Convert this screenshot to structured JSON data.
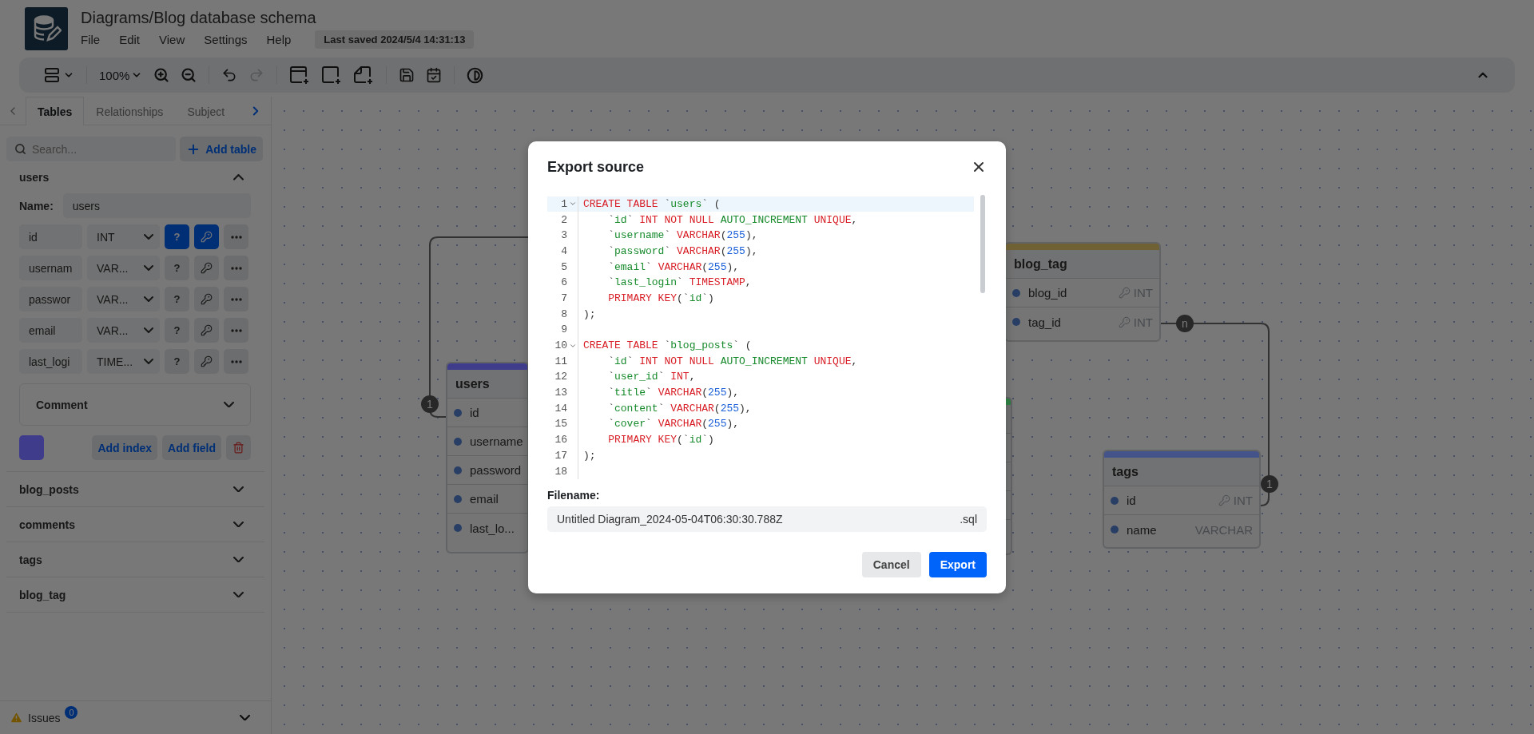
{
  "app": {
    "title": "Diagrams/Blog database schema",
    "menu": [
      "File",
      "Edit",
      "View",
      "Settings",
      "Help"
    ],
    "last_saved": "Last saved 2024/5/4 14:31:13"
  },
  "toolbar": {
    "zoom": "100%",
    "redo_disabled": true
  },
  "sidebar": {
    "tabs": [
      {
        "label": "Tables",
        "selected": true
      },
      {
        "label": "Relationships",
        "selected": false
      },
      {
        "label": "Subject",
        "selected": false
      }
    ],
    "search": {
      "placeholder": "Search..."
    },
    "add_table": "Add table",
    "tables": [
      {
        "name": "users",
        "expanded": true,
        "name_label": "Name:",
        "name_value": "users",
        "fields": [
          {
            "name": "id",
            "type": "INT",
            "not_null": true,
            "primary": true
          },
          {
            "name": "usernam",
            "type": "VAR...",
            "not_null": false,
            "primary": false
          },
          {
            "name": "passwor",
            "type": "VAR...",
            "not_null": false,
            "primary": false
          },
          {
            "name": "email",
            "type": "VAR...",
            "not_null": false,
            "primary": false
          },
          {
            "name": "last_logi",
            "type": "TIME...",
            "not_null": false,
            "primary": false
          }
        ],
        "null_symbol": "?",
        "comment": "Comment",
        "color": "#403c8c",
        "add_index": "Add index",
        "add_field": "Add field"
      },
      {
        "name": "blog_posts",
        "expanded": false
      },
      {
        "name": "comments",
        "expanded": false
      },
      {
        "name": "tags",
        "expanded": false
      },
      {
        "name": "blog_tag",
        "expanded": false
      }
    ],
    "issues": {
      "label": "Issues",
      "count": "0"
    }
  },
  "canvas": {
    "tables": [
      {
        "name": "users",
        "color": "#403c8c",
        "fields": [
          {
            "name": "id"
          },
          {
            "name": "username"
          },
          {
            "name": "password"
          },
          {
            "name": "email"
          },
          {
            "name": "last_lo..."
          }
        ]
      },
      {
        "name": "blog_tag",
        "color": "#6f6133",
        "fields": [
          {
            "name": "blog_id",
            "type": "INT",
            "primary": true
          },
          {
            "name": "tag_id",
            "type": "INT",
            "primary": true
          }
        ]
      },
      {
        "name": "tags",
        "color": "#44548a",
        "fields": [
          {
            "name": "id",
            "type": "INT",
            "primary": true
          },
          {
            "name": "name",
            "type": "VARCHAR",
            "primary": false
          }
        ]
      },
      {
        "color": "#2d7a40"
      }
    ],
    "relationships": [
      {
        "markers": [
          "1"
        ]
      },
      {
        "markers": [
          "n",
          "1"
        ]
      }
    ]
  },
  "dialog": {
    "title": "Export source",
    "code": [
      {
        "number": "1",
        "active": true,
        "foldable": true,
        "tokens": [
          {
            "kind": "keyword",
            "text": "CREATE TABLE "
          },
          {
            "kind": "plain",
            "text": "`"
          },
          {
            "kind": "name",
            "text": "users"
          },
          {
            "kind": "plain",
            "text": "` ("
          }
        ]
      },
      {
        "number": "2",
        "active": false,
        "foldable": false,
        "tokens": [
          {
            "kind": "plain",
            "text": "    `"
          },
          {
            "kind": "name",
            "text": "id"
          },
          {
            "kind": "plain",
            "text": "` "
          },
          {
            "kind": "keyword",
            "text": "INT NOT NULL "
          },
          {
            "kind": "name",
            "text": "AUTO_INCREMENT "
          },
          {
            "kind": "keyword",
            "text": "UNIQUE"
          },
          {
            "kind": "plain",
            "text": ","
          }
        ]
      },
      {
        "number": "3",
        "active": false,
        "foldable": false,
        "tokens": [
          {
            "kind": "plain",
            "text": "    `"
          },
          {
            "kind": "name",
            "text": "username"
          },
          {
            "kind": "plain",
            "text": "` "
          },
          {
            "kind": "keyword",
            "text": "VARCHAR"
          },
          {
            "kind": "plain",
            "text": "("
          },
          {
            "kind": "number",
            "text": "255"
          },
          {
            "kind": "plain",
            "text": "),"
          }
        ]
      },
      {
        "number": "4",
        "active": false,
        "foldable": false,
        "tokens": [
          {
            "kind": "plain",
            "text": "    `"
          },
          {
            "kind": "name",
            "text": "password"
          },
          {
            "kind": "plain",
            "text": "` "
          },
          {
            "kind": "keyword",
            "text": "VARCHAR"
          },
          {
            "kind": "plain",
            "text": "("
          },
          {
            "kind": "number",
            "text": "255"
          },
          {
            "kind": "plain",
            "text": "),"
          }
        ]
      },
      {
        "number": "5",
        "active": false,
        "foldable": false,
        "tokens": [
          {
            "kind": "plain",
            "text": "    `"
          },
          {
            "kind": "name",
            "text": "email"
          },
          {
            "kind": "plain",
            "text": "` "
          },
          {
            "kind": "keyword",
            "text": "VARCHAR"
          },
          {
            "kind": "plain",
            "text": "("
          },
          {
            "kind": "number",
            "text": "255"
          },
          {
            "kind": "plain",
            "text": "),"
          }
        ]
      },
      {
        "number": "6",
        "active": false,
        "foldable": false,
        "tokens": [
          {
            "kind": "plain",
            "text": "    `"
          },
          {
            "kind": "name",
            "text": "last_login"
          },
          {
            "kind": "plain",
            "text": "` "
          },
          {
            "kind": "keyword",
            "text": "TIMESTAMP"
          },
          {
            "kind": "plain",
            "text": ","
          }
        ]
      },
      {
        "number": "7",
        "active": false,
        "foldable": false,
        "tokens": [
          {
            "kind": "keyword",
            "text": "    PRIMARY KEY"
          },
          {
            "kind": "plain",
            "text": "(`"
          },
          {
            "kind": "name",
            "text": "id"
          },
          {
            "kind": "plain",
            "text": "`)"
          }
        ]
      },
      {
        "number": "8",
        "active": false,
        "foldable": false,
        "tokens": [
          {
            "kind": "plain",
            "text": ");"
          }
        ]
      },
      {
        "number": "9",
        "active": false,
        "foldable": false
      },
      {
        "number": "10",
        "active": false,
        "foldable": true,
        "tokens": [
          {
            "kind": "keyword",
            "text": "CREATE TABLE "
          },
          {
            "kind": "plain",
            "text": "`"
          },
          {
            "kind": "name",
            "text": "blog_posts"
          },
          {
            "kind": "plain",
            "text": "` ("
          }
        ]
      },
      {
        "number": "11",
        "active": false,
        "foldable": false,
        "tokens": [
          {
            "kind": "plain",
            "text": "    `"
          },
          {
            "kind": "name",
            "text": "id"
          },
          {
            "kind": "plain",
            "text": "` "
          },
          {
            "kind": "keyword",
            "text": "INT NOT NULL "
          },
          {
            "kind": "name",
            "text": "AUTO_INCREMENT "
          },
          {
            "kind": "keyword",
            "text": "UNIQUE"
          },
          {
            "kind": "plain",
            "text": ","
          }
        ]
      },
      {
        "number": "12",
        "active": false,
        "foldable": false,
        "tokens": [
          {
            "kind": "plain",
            "text": "    `"
          },
          {
            "kind": "name",
            "text": "user_id"
          },
          {
            "kind": "plain",
            "text": "` "
          },
          {
            "kind": "keyword",
            "text": "INT"
          },
          {
            "kind": "plain",
            "text": ","
          }
        ]
      },
      {
        "number": "13",
        "active": false,
        "foldable": false,
        "tokens": [
          {
            "kind": "plain",
            "text": "    `"
          },
          {
            "kind": "name",
            "text": "title"
          },
          {
            "kind": "plain",
            "text": "` "
          },
          {
            "kind": "keyword",
            "text": "VARCHAR"
          },
          {
            "kind": "plain",
            "text": "("
          },
          {
            "kind": "number",
            "text": "255"
          },
          {
            "kind": "plain",
            "text": "),"
          }
        ]
      },
      {
        "number": "14",
        "active": false,
        "foldable": false,
        "tokens": [
          {
            "kind": "plain",
            "text": "    `"
          },
          {
            "kind": "name",
            "text": "content"
          },
          {
            "kind": "plain",
            "text": "` "
          },
          {
            "kind": "keyword",
            "text": "VARCHAR"
          },
          {
            "kind": "plain",
            "text": "("
          },
          {
            "kind": "number",
            "text": "255"
          },
          {
            "kind": "plain",
            "text": "),"
          }
        ]
      },
      {
        "number": "15",
        "active": false,
        "foldable": false,
        "tokens": [
          {
            "kind": "plain",
            "text": "    `"
          },
          {
            "kind": "name",
            "text": "cover"
          },
          {
            "kind": "plain",
            "text": "` "
          },
          {
            "kind": "keyword",
            "text": "VARCHAR"
          },
          {
            "kind": "plain",
            "text": "("
          },
          {
            "kind": "number",
            "text": "255"
          },
          {
            "kind": "plain",
            "text": "),"
          }
        ]
      },
      {
        "number": "16",
        "active": false,
        "foldable": false,
        "tokens": [
          {
            "kind": "keyword",
            "text": "    PRIMARY KEY"
          },
          {
            "kind": "plain",
            "text": "(`"
          },
          {
            "kind": "name",
            "text": "id"
          },
          {
            "kind": "plain",
            "text": "`)"
          }
        ]
      },
      {
        "number": "17",
        "active": false,
        "foldable": false,
        "tokens": [
          {
            "kind": "plain",
            "text": ");"
          }
        ]
      },
      {
        "number": "18",
        "active": false,
        "foldable": false
      }
    ],
    "filename_label": "Filename:",
    "filename": "Untitled Diagram_2024-05-04T06:30:30.788Z",
    "extension": ".sql",
    "buttons": [
      {
        "label": "Cancel",
        "kind": "secondary"
      },
      {
        "label": "Export",
        "kind": "primary"
      }
    ]
  }
}
